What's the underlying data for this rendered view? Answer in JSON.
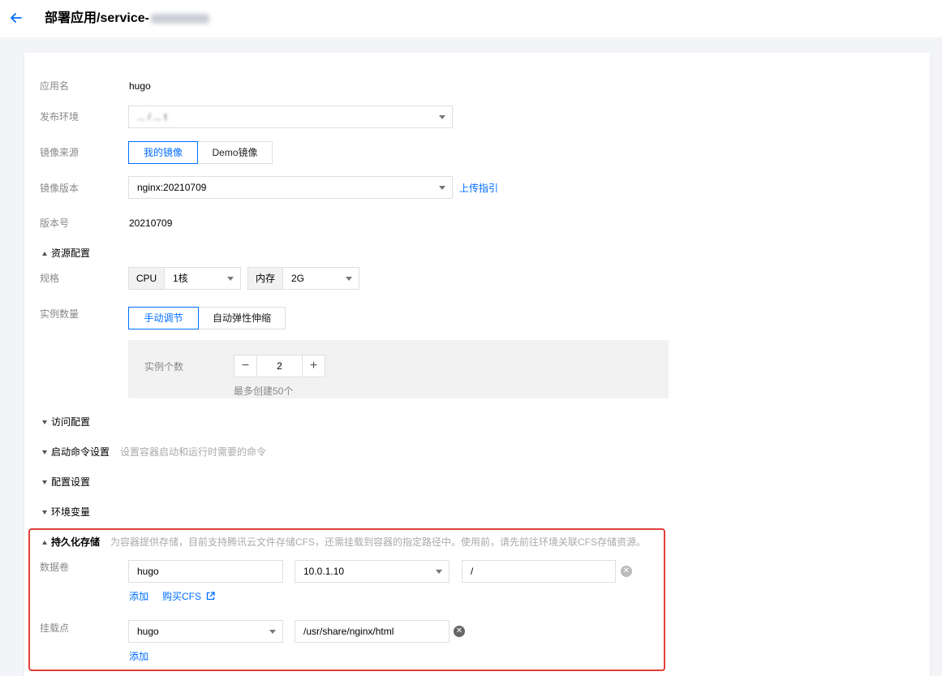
{
  "header": {
    "title": "部署应用/service-",
    "back_icon": "arrow-left-icon"
  },
  "form": {
    "app_name": {
      "label": "应用名",
      "value": "hugo"
    },
    "env": {
      "label": "发布环境",
      "value": "... / ... t"
    },
    "image_source": {
      "label": "镜像来源",
      "options": [
        "我的镜像",
        "Demo镜像"
      ],
      "selected": "我的镜像"
    },
    "image_version": {
      "label": "镜像版本",
      "value": "nginx:20210709",
      "upload_link": "上传指引"
    },
    "version_no": {
      "label": "版本号",
      "value": "20210709"
    },
    "resource_section": {
      "label": "资源配置"
    },
    "spec": {
      "label": "规格",
      "cpu_label": "CPU",
      "cpu_value": "1核",
      "mem_label": "内存",
      "mem_value": "2G"
    },
    "instance_count": {
      "label": "实例数量",
      "modes": [
        "手动调节",
        "自动弹性伸缩"
      ],
      "selected": "手动调节",
      "count_label": "实例个数",
      "count_value": "2",
      "minus": "−",
      "plus": "+",
      "max_hint": "最多创建50个"
    },
    "access_section": {
      "label": "访问配置"
    },
    "startup_section": {
      "label": "启动命令设置",
      "hint": "设置容器启动和运行时需要的命令"
    },
    "config_section": {
      "label": "配置设置"
    },
    "env_var_section": {
      "label": "环境变量"
    },
    "storage_section": {
      "label": "持久化存储",
      "hint": "为容器提供存储，目前支持腾讯云文件存储CFS，还需挂载到容器的指定路径中。使用前，请先前往环境关联CFS存储资源。"
    },
    "data_volume": {
      "label": "数据卷",
      "name": "hugo",
      "ip": "10.0.1.10",
      "path": "/",
      "add": "添加",
      "buy_cfs": "购买CFS"
    },
    "mount_point": {
      "label": "挂载点",
      "volume": "hugo",
      "path": "/usr/share/nginx/html",
      "add": "添加"
    }
  },
  "colors": {
    "accent": "#006eff",
    "highlight_border": "#e0403a"
  }
}
